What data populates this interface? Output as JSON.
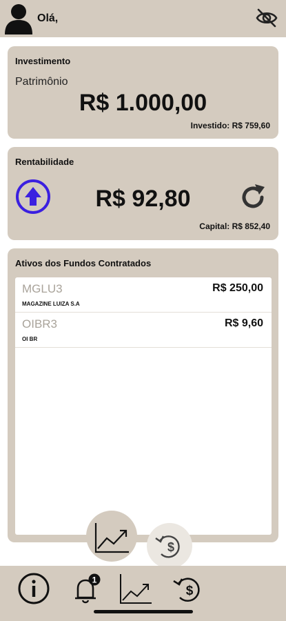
{
  "header": {
    "greeting": "Olá,",
    "avatar_icon": "user-silhouette-icon",
    "visibility_icon": "eye-off-icon"
  },
  "investimento": {
    "title": "Investimento",
    "patrimonio_label": "Patrimônio",
    "patrimonio_value": "R$ 1.000,00",
    "investido": "Investido: R$ 759,60"
  },
  "rentabilidade": {
    "title": "Rentabilidade",
    "value": "R$ 92,80",
    "capital": "Capital: R$ 852,40",
    "trend_icon": "arrow-up-circle-icon",
    "refresh_icon": "refresh-icon"
  },
  "ativos": {
    "title": "Ativos dos Fundos Contratados",
    "items": [
      {
        "ticker": "MGLU3",
        "name": "MAGAZINE LUIZA S.A",
        "value": "R$ 250,00"
      },
      {
        "ticker": "OIBR3",
        "name": "OI BR",
        "value": "R$ 9,60"
      }
    ]
  },
  "tabbar": {
    "notification_badge": "1",
    "tabs": [
      "info-icon",
      "bell-icon",
      "chart-icon",
      "money-cycle-icon"
    ]
  },
  "colors": {
    "panel": "#d4cbbf",
    "accent": "#3b20e0",
    "ticker": "#a9a39a"
  }
}
